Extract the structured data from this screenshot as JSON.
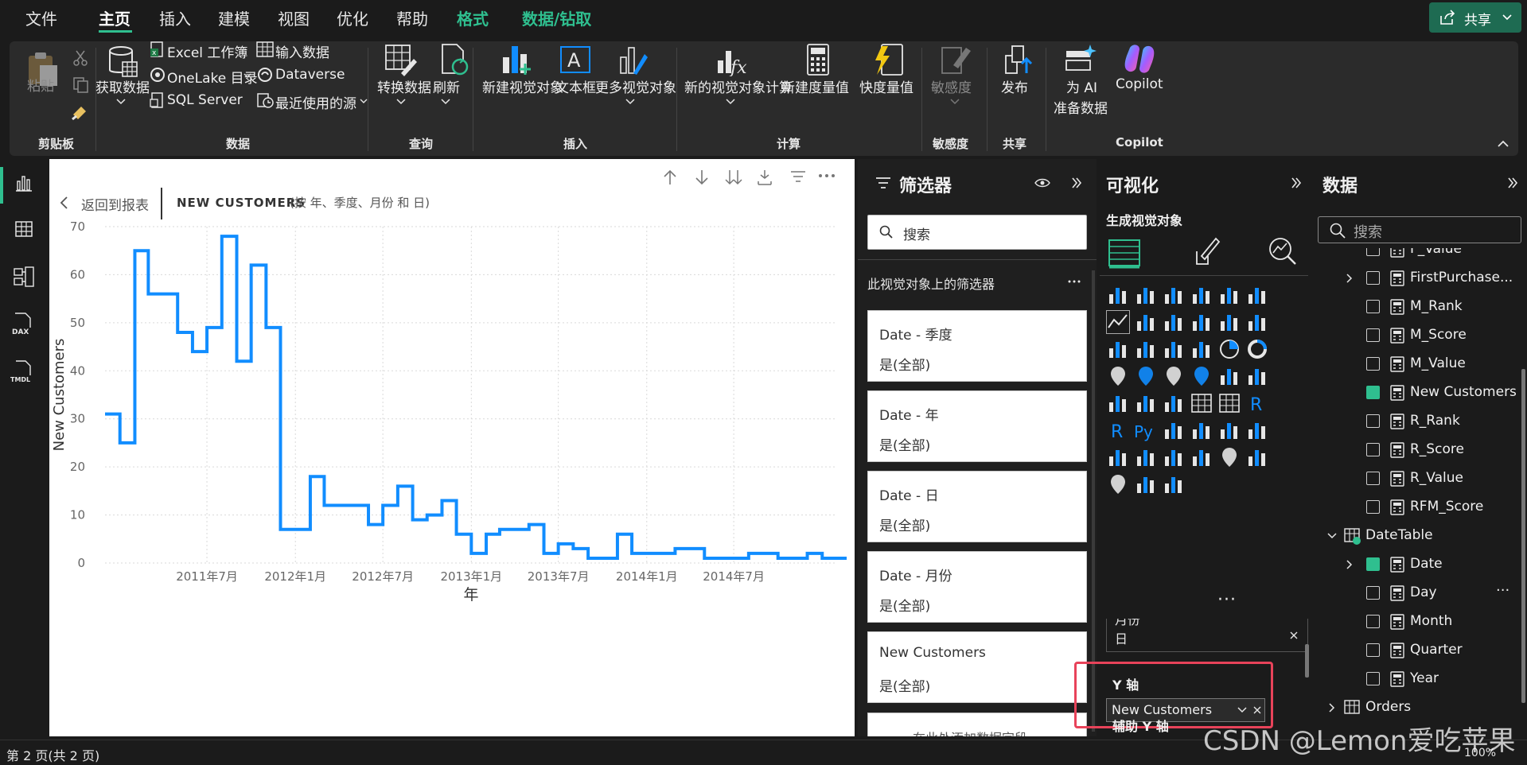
{
  "menu": {
    "file": "文件",
    "home": "主页",
    "insert": "插入",
    "modeling": "建模",
    "view": "视图",
    "optimize": "优化",
    "help": "帮助",
    "format": "格式",
    "data_drill": "数据/钻取",
    "share": "共享"
  },
  "ribbon": {
    "paste": "粘贴",
    "clipboard": "剪贴板",
    "get_data": "获取数据",
    "excel": "Excel 工作簿",
    "onelake": "OneLake 目录",
    "sql": "SQL Server",
    "enter_data": "输入数据",
    "dataverse": "Dataverse",
    "recent": "最近使用的源",
    "data_group": "数据",
    "transform": "转换数据",
    "refresh": "刷新",
    "query_group": "查询",
    "new_visual": "新建视觉对象",
    "textbox": "文本框",
    "more_visuals": "更多视觉对象",
    "insert_group": "插入",
    "new_visual_calc": "新的视觉对象计算",
    "new_measure": "新建度量值",
    "quick_measure": "快度量值",
    "calc_group": "计算",
    "sensitivity": "敏感度",
    "sensitivity_group": "敏感度",
    "publish": "发布",
    "share_group": "共享",
    "ai_prep_1": "为 AI",
    "ai_prep_2": "准备数据",
    "copilot": "Copilot",
    "copilot_group": "Copilot"
  },
  "visual": {
    "back": "返回到报表",
    "title": "NEW CUSTOMERS",
    "subtitle": "(按 年、季度、月份 和 日)",
    "ylabel": "New Customers",
    "xlabel": "年"
  },
  "chart_data": {
    "type": "line",
    "step": true,
    "title": "NEW CUSTOMERS",
    "subtitle": "(按 年、季度、月份 和 日)",
    "xlabel": "年",
    "ylabel": "New Customers",
    "ylim": [
      0,
      70
    ],
    "yticks": [
      0,
      10,
      20,
      30,
      40,
      50,
      60,
      70
    ],
    "xticks": [
      "2011年7月",
      "2012年1月",
      "2012年7月",
      "2013年1月",
      "2013年7月",
      "2014年1月",
      "2014年7月"
    ],
    "xtick_dates": [
      "2011-07-01",
      "2012-01-01",
      "2012-07-01",
      "2013-01-01",
      "2013-07-01",
      "2014-01-01",
      "2014-07-01"
    ],
    "grid": true,
    "color": "#118DFF",
    "series": [
      {
        "points": [
          [
            "2010-12-01",
            31
          ],
          [
            "2011-01-01",
            25
          ],
          [
            "2011-02-01",
            65
          ],
          [
            "2011-03-01",
            56
          ],
          [
            "2011-05-01",
            48
          ],
          [
            "2011-06-01",
            44
          ],
          [
            "2011-07-01",
            49
          ],
          [
            "2011-08-01",
            68
          ],
          [
            "2011-09-01",
            42
          ],
          [
            "2011-10-01",
            62
          ],
          [
            "2011-11-01",
            49
          ],
          [
            "2011-12-01",
            7
          ],
          [
            "2012-02-01",
            18
          ],
          [
            "2012-03-01",
            12
          ],
          [
            "2012-06-01",
            8
          ],
          [
            "2012-07-01",
            12
          ],
          [
            "2012-08-01",
            16
          ],
          [
            "2012-09-01",
            9
          ],
          [
            "2012-10-01",
            10
          ],
          [
            "2012-11-01",
            13
          ],
          [
            "2012-12-01",
            6
          ],
          [
            "2013-01-01",
            2
          ],
          [
            "2013-02-01",
            6
          ],
          [
            "2013-03-01",
            7
          ],
          [
            "2013-05-01",
            8
          ],
          [
            "2013-06-01",
            2
          ],
          [
            "2013-07-01",
            4
          ],
          [
            "2013-08-01",
            3
          ],
          [
            "2013-09-01",
            1
          ],
          [
            "2013-11-01",
            6
          ],
          [
            "2013-12-01",
            2
          ],
          [
            "2014-01-01",
            2
          ],
          [
            "2014-03-01",
            3
          ],
          [
            "2014-05-01",
            1
          ],
          [
            "2014-07-01",
            1
          ],
          [
            "2014-08-01",
            2
          ],
          [
            "2014-09-01",
            2
          ],
          [
            "2014-10-01",
            1
          ],
          [
            "2014-12-01",
            2
          ],
          [
            "2015-01-01",
            1
          ],
          [
            "2015-02-01",
            1
          ]
        ]
      }
    ]
  },
  "filters": {
    "title": "筛选器",
    "search_placeholder": "搜索",
    "section": "此视觉对象上的筛选器",
    "cards": [
      {
        "title": "Date - 季度",
        "value": "是(全部)"
      },
      {
        "title": "Date - 年",
        "value": "是(全部)"
      },
      {
        "title": "Date - 日",
        "value": "是(全部)"
      },
      {
        "title": "Date - 月份",
        "value": "是(全部)"
      },
      {
        "title": "New Customers",
        "value": "是(全部)"
      }
    ],
    "add_field": "在此处添加数据字段"
  },
  "viz": {
    "title": "可视化",
    "build": "生成视觉对象",
    "r_label": "R",
    "py_label": "Py",
    "more": "···",
    "well_month": "月份",
    "well_day": "日",
    "y_axis": "Y 轴",
    "y_field": "New Customers",
    "secondary_y": "辅助 Y 轴"
  },
  "data_pane": {
    "title": "数据",
    "search_placeholder": "搜索",
    "fields": [
      {
        "label": "F_Value",
        "checked": false
      },
      {
        "label": "FirstPurchase...",
        "checked": false,
        "expand": true
      },
      {
        "label": "M_Rank",
        "checked": false
      },
      {
        "label": "M_Score",
        "checked": false
      },
      {
        "label": "M_Value",
        "checked": false
      },
      {
        "label": "New Customers",
        "checked": true
      },
      {
        "label": "R_Rank",
        "checked": false
      },
      {
        "label": "R_Score",
        "checked": false
      },
      {
        "label": "R_Value",
        "checked": false
      },
      {
        "label": "RFM_Score",
        "checked": false
      }
    ],
    "datetable": "DateTable",
    "date_fields": [
      {
        "label": "Date",
        "checked": true,
        "expand": true
      },
      {
        "label": "Day",
        "checked": false
      },
      {
        "label": "Month",
        "checked": false
      },
      {
        "label": "Quarter",
        "checked": false
      },
      {
        "label": "Year",
        "checked": false
      }
    ],
    "orders": "Orders",
    "more": "···"
  },
  "status": {
    "page": "第 2 页(共 2 页)",
    "zoom": "100%"
  },
  "watermark": "CSDN @Lemon爱吃苹果"
}
